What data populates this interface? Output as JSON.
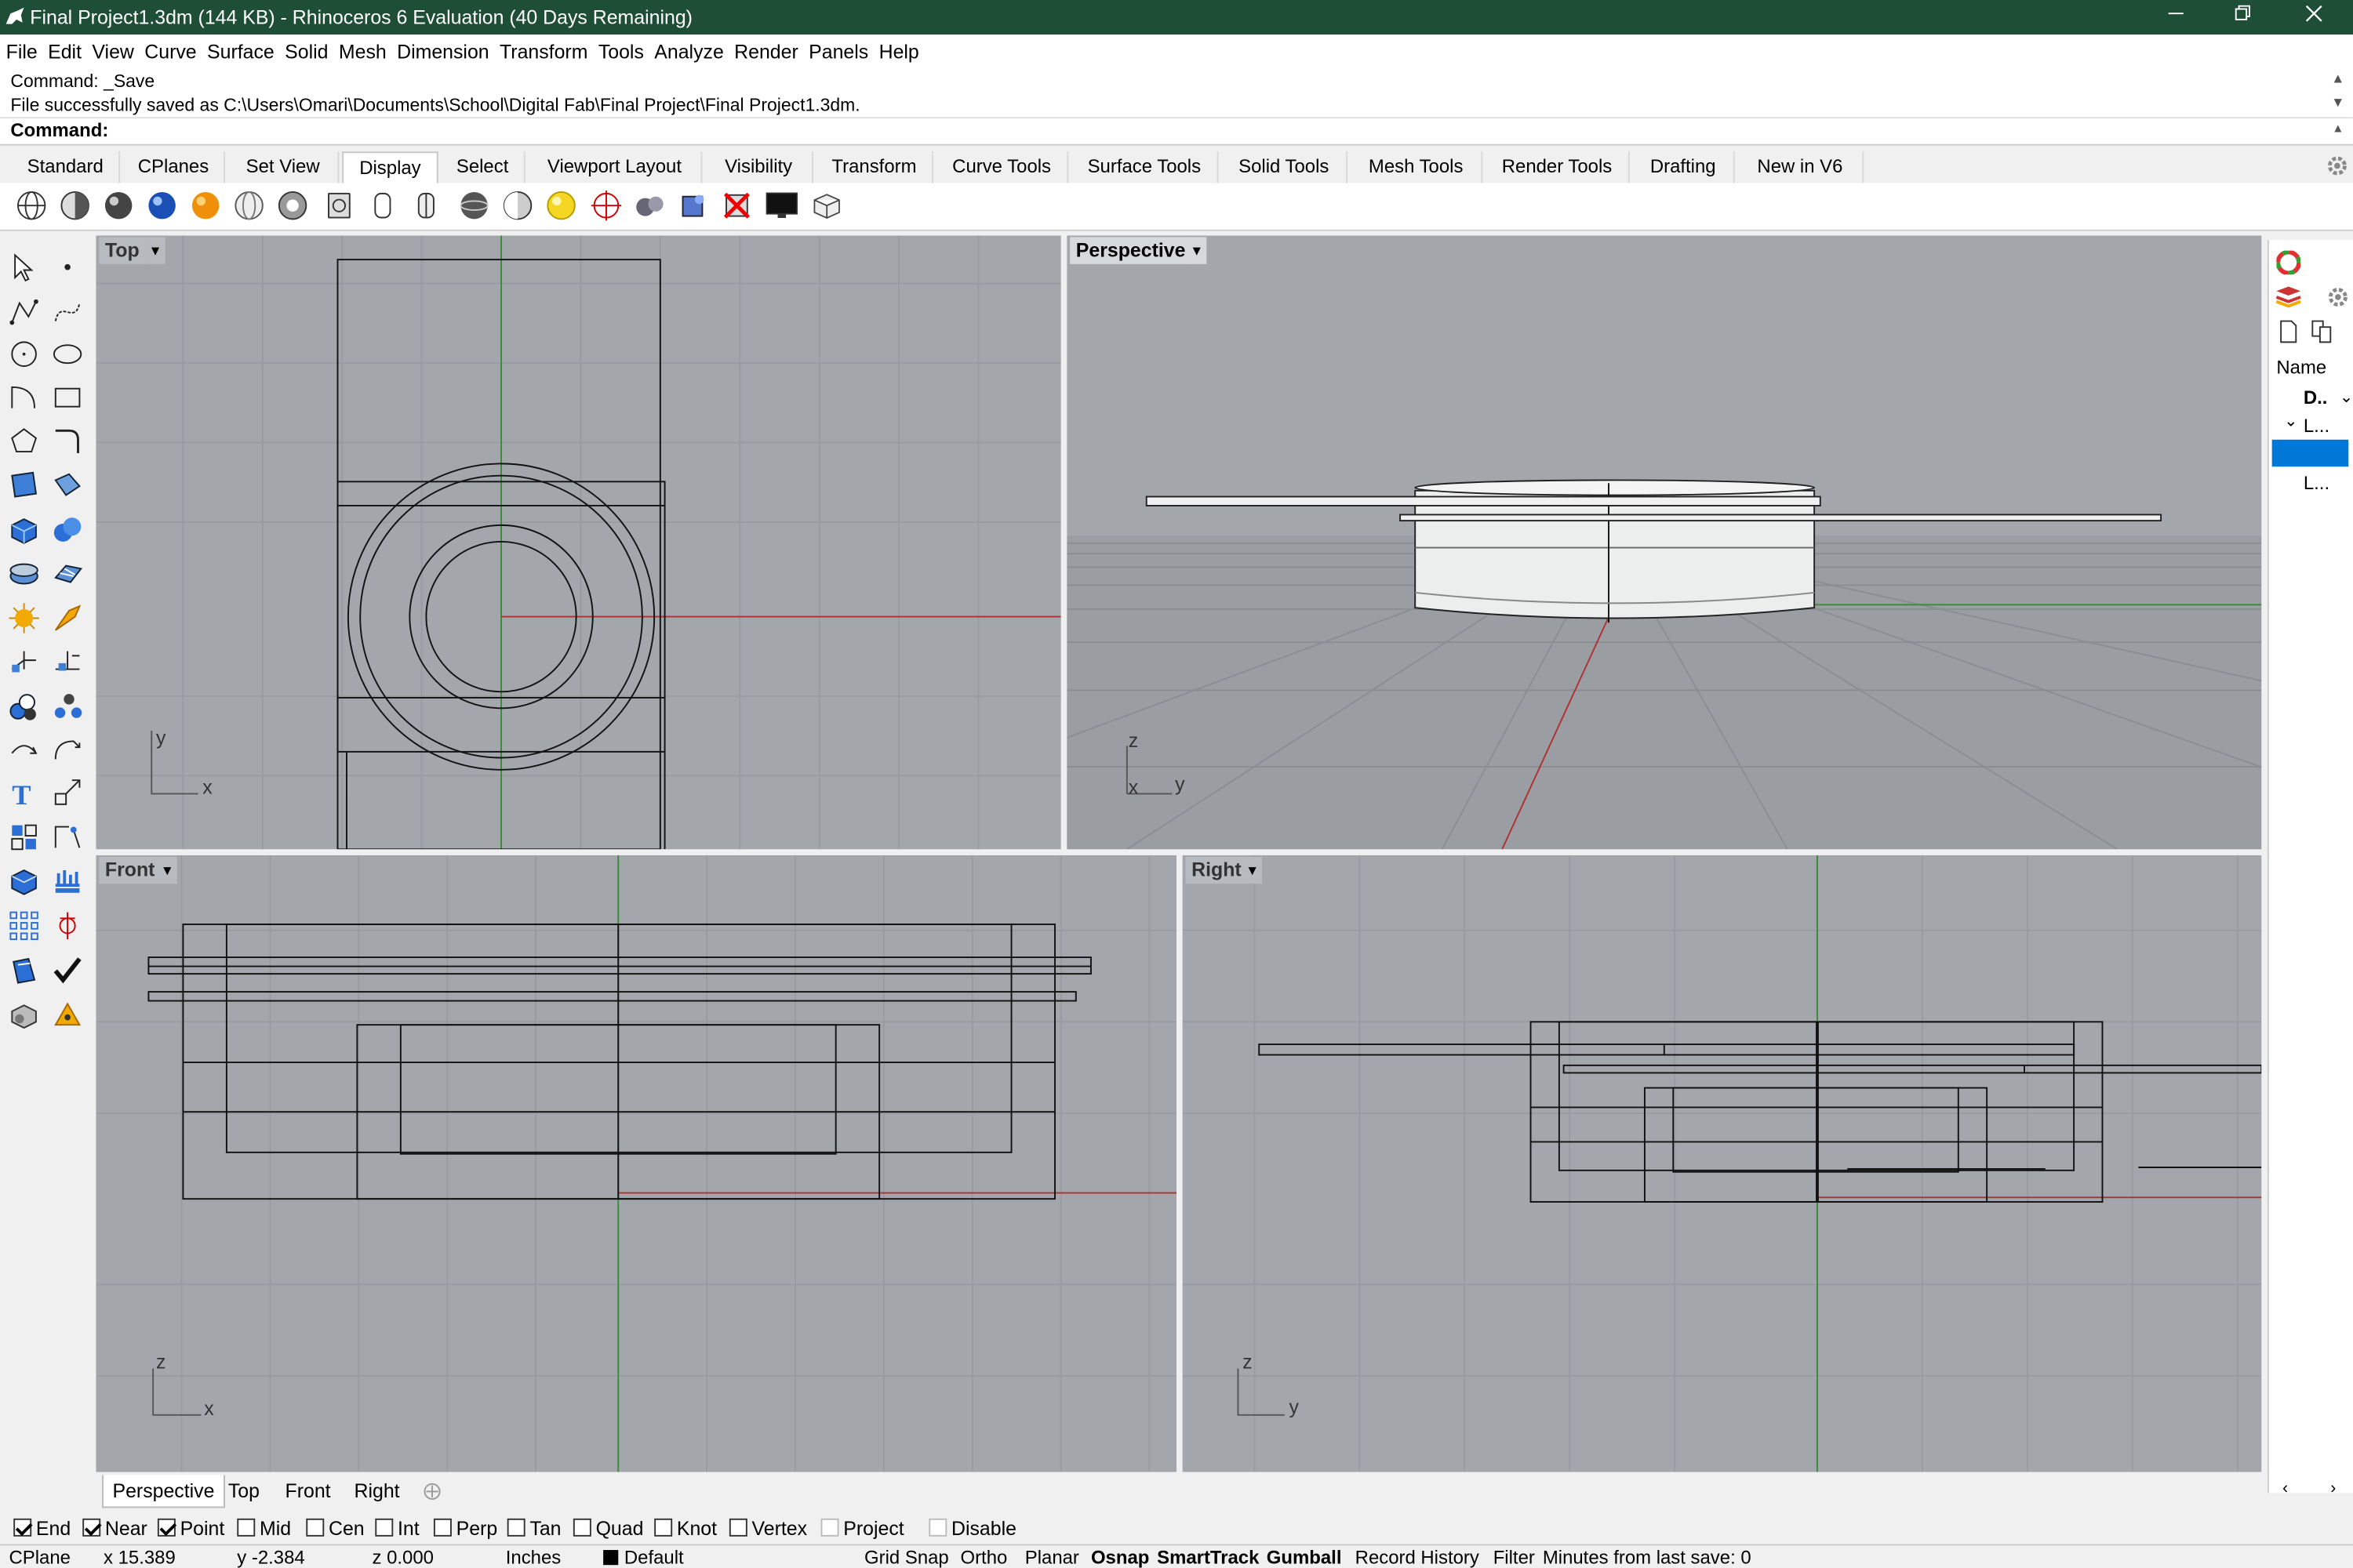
{
  "window": {
    "title": "Final Project1.3dm (144 KB) - Rhinoceros 6 Evaluation (40 Days Remaining)",
    "minimize_icon": "minimize-icon",
    "restore_icon": "restore-icon",
    "close_icon": "close-icon",
    "title_bar_color": "#1f4e37"
  },
  "menu": [
    "File",
    "Edit",
    "View",
    "Curve",
    "Surface",
    "Solid",
    "Mesh",
    "Dimension",
    "Transform",
    "Tools",
    "Analyze",
    "Render",
    "Panels",
    "Help"
  ],
  "command": {
    "history_1": "Command: _Save",
    "history_2": "File successfully saved as C:\\Users\\Omari\\Documents\\School\\Digital Fab\\Final Project\\Final Project1.3dm.",
    "prompt": "Command:"
  },
  "toolbar_tabs": [
    "Standard",
    "CPlanes",
    "Set View",
    "Display",
    "Select",
    "Viewport Layout",
    "Visibility",
    "Transform",
    "Curve Tools",
    "Surface Tools",
    "Solid Tools",
    "Mesh Tools",
    "Render Tools",
    "Drafting",
    "New in V6"
  ],
  "active_toolbar_tab": "Display",
  "display_icons": [
    "wireframe-icon",
    "shaded-icon",
    "rendered-icon",
    "rendered-blue-icon",
    "rendered-orange-icon",
    "ghosted-icon",
    "xray-icon",
    "technical-icon",
    "artistic-icon",
    "pen-icon",
    "arctic-icon",
    "raytraced-icon",
    "lights-icon",
    "sun-icon",
    "flat-shade-icon",
    "materials-icon",
    "backfaces-icon",
    "disable-render-icon",
    "monitor-icon",
    "isometric-icon"
  ],
  "viewports": {
    "top": {
      "label": "Top",
      "axis_a": "x",
      "axis_b": "y"
    },
    "perspective": {
      "label": "Perspective",
      "axis_a": "y",
      "axis_b": "z",
      "axis_c": "x"
    },
    "front": {
      "label": "Front",
      "axis_a": "x",
      "axis_b": "z"
    },
    "right": {
      "label": "Right",
      "axis_a": "y",
      "axis_b": "z"
    }
  },
  "viewport_tabs": [
    "Perspective",
    "Top",
    "Front",
    "Right"
  ],
  "active_viewport_tab": "Perspective",
  "layers_panel": {
    "header": "Name",
    "row_1": "D..",
    "row_2": "L...",
    "row_3": "L..."
  },
  "osnaps": [
    {
      "label": "End",
      "checked": true
    },
    {
      "label": "Near",
      "checked": true
    },
    {
      "label": "Point",
      "checked": true
    },
    {
      "label": "Mid",
      "checked": false
    },
    {
      "label": "Cen",
      "checked": false
    },
    {
      "label": "Int",
      "checked": false
    },
    {
      "label": "Perp",
      "checked": false
    },
    {
      "label": "Tan",
      "checked": false
    },
    {
      "label": "Quad",
      "checked": false
    },
    {
      "label": "Knot",
      "checked": false
    },
    {
      "label": "Vertex",
      "checked": false
    },
    {
      "label": "Project",
      "checked": false
    },
    {
      "label": "Disable",
      "checked": false
    }
  ],
  "status": {
    "cplane": "CPlane",
    "x": "x 15.389",
    "y": "y -2.384",
    "z": "z 0.000",
    "units": "Inches",
    "layer": "Default",
    "grid_snap": "Grid Snap",
    "ortho": "Ortho",
    "planar": "Planar",
    "osnap": "Osnap",
    "smarttrack": "SmartTrack",
    "gumball": "Gumball",
    "record_history": "Record History",
    "filter": "Filter",
    "save_info": "Minutes from last save: 0"
  }
}
